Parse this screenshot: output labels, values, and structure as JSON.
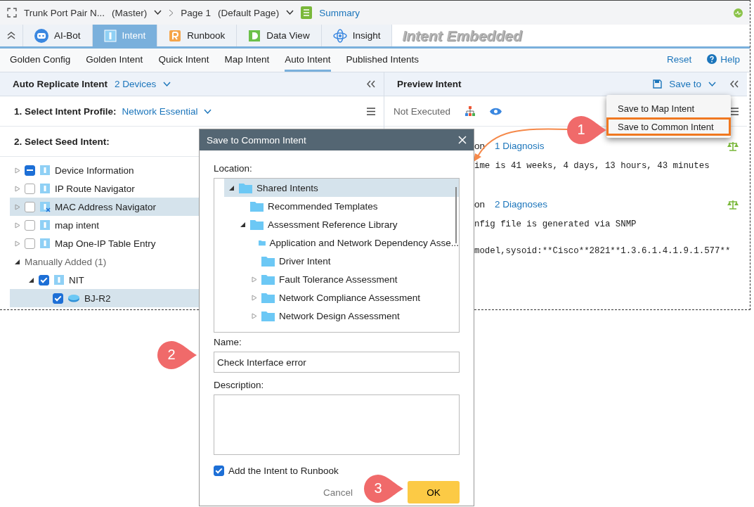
{
  "title_bar": {
    "document": "Trunk Port Pair N...",
    "branch": "(Master)",
    "page": "Page 1",
    "page_note": "(Default Page)",
    "summary": "Summary"
  },
  "tabs": [
    {
      "label": "AI-Bot",
      "kind": "bot",
      "selected": false
    },
    {
      "label": "Intent",
      "kind": "intent",
      "selected": true
    },
    {
      "label": "Runbook",
      "kind": "runbook",
      "selected": false
    },
    {
      "label": "Data View",
      "kind": "dataview",
      "selected": false
    },
    {
      "label": "Insight",
      "kind": "insight",
      "selected": false
    }
  ],
  "banner": "Intent Embedded",
  "subtabs": [
    {
      "label": "Golden Config",
      "selected": false
    },
    {
      "label": "Golden Intent",
      "selected": false
    },
    {
      "label": "Quick Intent",
      "selected": false
    },
    {
      "label": "Map Intent",
      "selected": false
    },
    {
      "label": "Auto Intent",
      "selected": true
    },
    {
      "label": "Published Intents",
      "selected": false
    }
  ],
  "subtab_actions": {
    "reset": "Reset",
    "help": "Help"
  },
  "left_panel": {
    "title": "Auto Replicate Intent",
    "devices": "2 Devices",
    "profile_label": "1. Select Intent Profile:",
    "profile_value": "Network Essential",
    "seed_label": "2. Select Seed Intent:",
    "tree": [
      {
        "label": "Device Information",
        "partial": true,
        "selected": false,
        "kind": "intent"
      },
      {
        "label": "IP Route Navigator",
        "checked": false,
        "selected": false,
        "kind": "intent"
      },
      {
        "label": "MAC Address Navigator",
        "checked": false,
        "selected": true,
        "kind": "intent-error"
      },
      {
        "label": "map intent",
        "checked": false,
        "selected": false,
        "kind": "intent"
      },
      {
        "label": "Map One-IP Table Entry",
        "checked": false,
        "selected": false,
        "kind": "intent"
      },
      {
        "label": "Manually Added (1)",
        "kind": "group",
        "expanded": true,
        "children": [
          {
            "label": "NIT",
            "checked": true,
            "selected": false,
            "kind": "intent",
            "expanded": true,
            "children": [
              {
                "label": "BJ-R2",
                "checked": true,
                "selected": true,
                "kind": "device"
              }
            ]
          }
        ]
      }
    ]
  },
  "right_panel": {
    "title": "Preview Intent",
    "save_to": "Save to",
    "status": "Not Executed",
    "results": [
      {
        "name": "on",
        "diagnosis": "1 Diagnosis",
        "lines": [
          "ime is 41 weeks, 4 days, 13 hours, 43 minutes"
        ]
      },
      {
        "name": "on",
        "diagnosis": "2 Diagnoses",
        "lines": [
          "nfig file is generated via SNMP",
          "model,sysoid:**Cisco**2821**1.3.6.1.4.1.9.1.577**"
        ]
      }
    ]
  },
  "save_menu": [
    {
      "label": "Save to Map Intent",
      "highlighted": false
    },
    {
      "label": "Save to Common Intent",
      "highlighted": true
    }
  ],
  "dialog": {
    "title": "Save to Common Intent",
    "location_label": "Location:",
    "folders": [
      {
        "label": "Shared Intents",
        "selected": true,
        "expanded": true,
        "children": [
          {
            "label": "Recommended Templates",
            "selected": false
          },
          {
            "label": "Assessment Reference Library",
            "selected": false,
            "expanded": true,
            "children": [
              {
                "label": "Application and Network Dependency Asse...",
                "selected": false
              },
              {
                "label": "Driver Intent",
                "selected": false
              },
              {
                "label": "Fault Tolerance Assessment",
                "selected": false,
                "expanded": false
              },
              {
                "label": "Network Compliance Assessment",
                "selected": false,
                "expanded": false
              },
              {
                "label": "Network Design Assessment",
                "selected": false,
                "expanded": false
              }
            ]
          }
        ]
      }
    ],
    "name_label": "Name:",
    "name_value": "Check Interface error",
    "description_label": "Description:",
    "add_to_runbook": {
      "label": "Add the Intent to Runbook",
      "checked": true
    },
    "cancel": "Cancel",
    "ok": "OK"
  },
  "callouts": [
    "1",
    "2",
    "3"
  ]
}
